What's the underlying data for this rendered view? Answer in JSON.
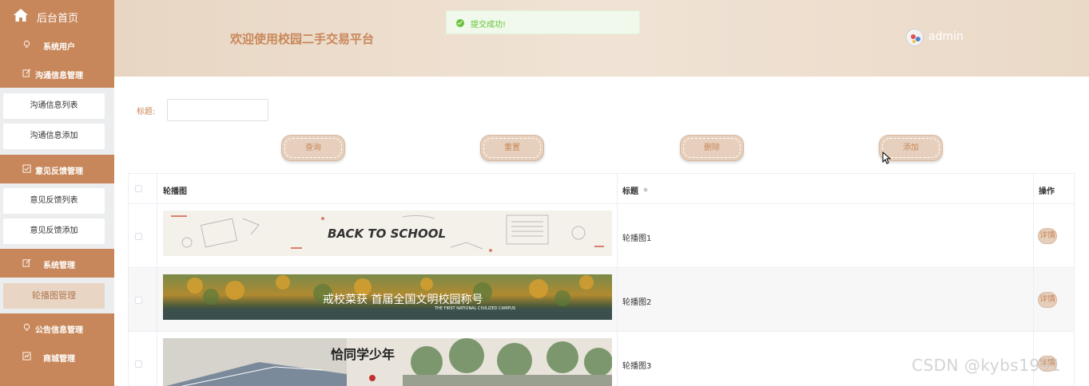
{
  "sidebar": {
    "home_label": "后台首页",
    "menus": [
      {
        "label": "系统用户"
      },
      {
        "label": "沟通信息管理",
        "items": [
          "沟通信息列表",
          "沟通信息添加"
        ]
      },
      {
        "label": "意见反馈管理",
        "items": [
          "意见反馈列表",
          "意见反馈添加"
        ]
      },
      {
        "label": "系统管理",
        "items": [
          "轮播图管理"
        ]
      },
      {
        "label": "公告信息管理"
      },
      {
        "label": "商城管理"
      }
    ],
    "active_item": "轮播图管理"
  },
  "header": {
    "title": "欢迎使用校园二手交易平台",
    "user": "admin"
  },
  "toast": {
    "message": "提交成功!"
  },
  "search": {
    "label": "标题:",
    "value": ""
  },
  "toolbar": {
    "query": "查询",
    "reset": "重置",
    "delete": "删除",
    "add": "添加"
  },
  "table": {
    "headers": {
      "image": "轮播图",
      "title": "标题",
      "actions": "操作"
    },
    "rows": [
      {
        "title": "轮播图1",
        "image_text": "BACK TO SCHOOL",
        "action": "详情"
      },
      {
        "title": "轮播图2",
        "image_text": "戒校菜获 首届全国文明校园称号",
        "image_subtext": "THE FIRST NATIONAL CIVILIZED CAMPUS",
        "action": "详情"
      },
      {
        "title": "轮播图3",
        "image_text": "恰同学少年",
        "action": "详情"
      }
    ]
  },
  "watermark": "CSDN @kybs1991",
  "colors": {
    "accent": "#c8875a",
    "header_bg": "#ecdccb",
    "success": "#67c23a"
  }
}
